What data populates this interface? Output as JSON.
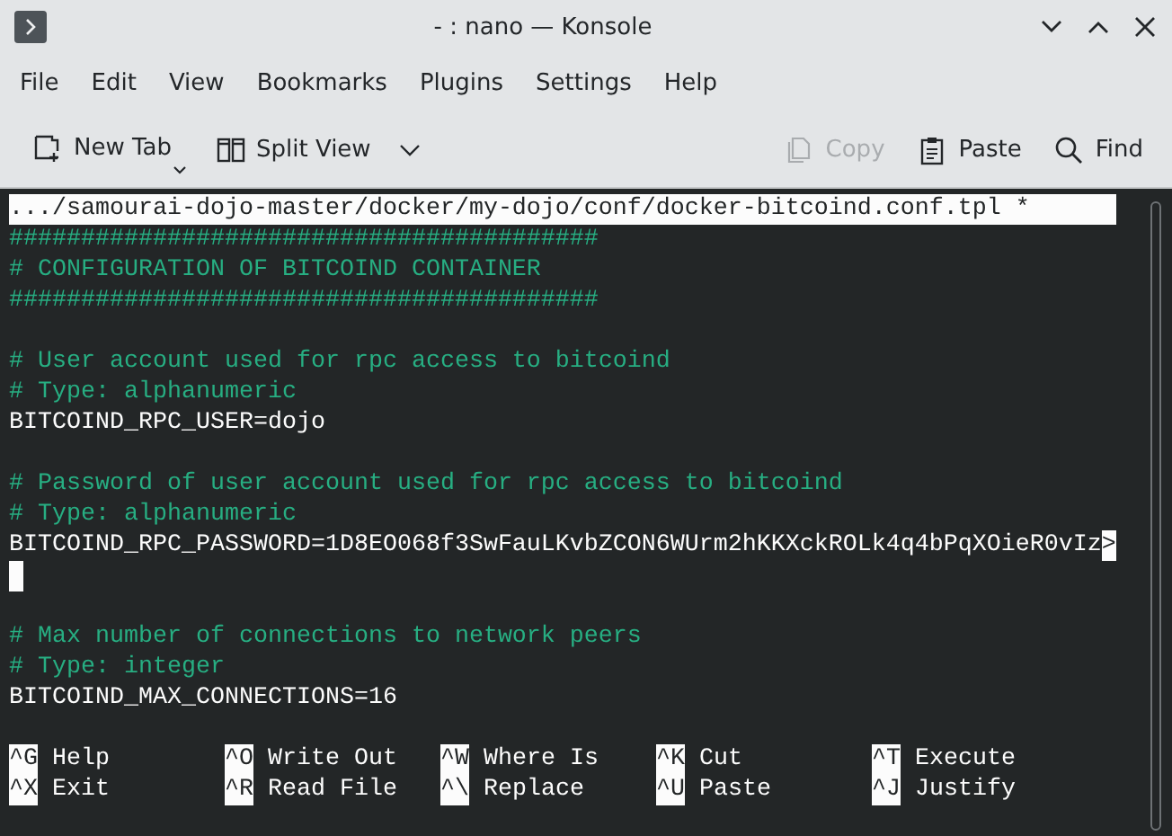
{
  "window": {
    "title": "- : nano — Konsole"
  },
  "menu": [
    "File",
    "Edit",
    "View",
    "Bookmarks",
    "Plugins",
    "Settings",
    "Help"
  ],
  "toolbar": {
    "left": [
      {
        "kind": "newtab",
        "label": "New Tab",
        "disabled": false
      },
      {
        "kind": "split",
        "label": "Split View",
        "disabled": false
      }
    ],
    "right": [
      {
        "kind": "copy",
        "label": "Copy",
        "disabled": true
      },
      {
        "kind": "paste",
        "label": "Paste",
        "disabled": false
      },
      {
        "kind": "find",
        "label": "Find",
        "disabled": false
      }
    ]
  },
  "editor": {
    "header": ".../samourai-dojo-master/docker/my-dojo/conf/docker-bitcoind.conf.tpl *",
    "lines": [
      {
        "kind": "comment",
        "text": "#########################################"
      },
      {
        "kind": "comment",
        "text": "# CONFIGURATION OF BITCOIND CONTAINER"
      },
      {
        "kind": "comment",
        "text": "#########################################"
      },
      {
        "kind": "blank"
      },
      {
        "kind": "comment",
        "text": "# User account used for rpc access to bitcoind"
      },
      {
        "kind": "comment",
        "text": "# Type: alphanumeric"
      },
      {
        "kind": "text",
        "text": "BITCOIND_RPC_USER=dojo"
      },
      {
        "kind": "blank"
      },
      {
        "kind": "comment",
        "text": "# Password of user account used for rpc access to bitcoind"
      },
      {
        "kind": "comment",
        "text": "# Type: alphanumeric"
      },
      {
        "kind": "text",
        "text": "BITCOIND_RPC_PASSWORD=1D8EO068f3SwFauLKvbZCON6WUrm2hKKXckROLk4q4bPqXOieR0vIz",
        "overflow_mark": ">"
      },
      {
        "kind": "cursor"
      },
      {
        "kind": "blank"
      },
      {
        "kind": "comment",
        "text": "# Max number of connections to network peers"
      },
      {
        "kind": "comment",
        "text": "# Type: integer"
      },
      {
        "kind": "text",
        "text": "BITCOIND_MAX_CONNECTIONS=16"
      },
      {
        "kind": "blank"
      }
    ],
    "shortcuts": [
      {
        "key": "^G",
        "label": "Help"
      },
      {
        "key": "^O",
        "label": "Write Out"
      },
      {
        "key": "^W",
        "label": "Where Is"
      },
      {
        "key": "^K",
        "label": "Cut"
      },
      {
        "key": "^T",
        "label": "Execute"
      },
      {
        "key": "^X",
        "label": "Exit"
      },
      {
        "key": "^R",
        "label": "Read File"
      },
      {
        "key": "^\\",
        "label": "Replace"
      },
      {
        "key": "^U",
        "label": "Paste"
      },
      {
        "key": "^J",
        "label": "Justify"
      }
    ]
  }
}
